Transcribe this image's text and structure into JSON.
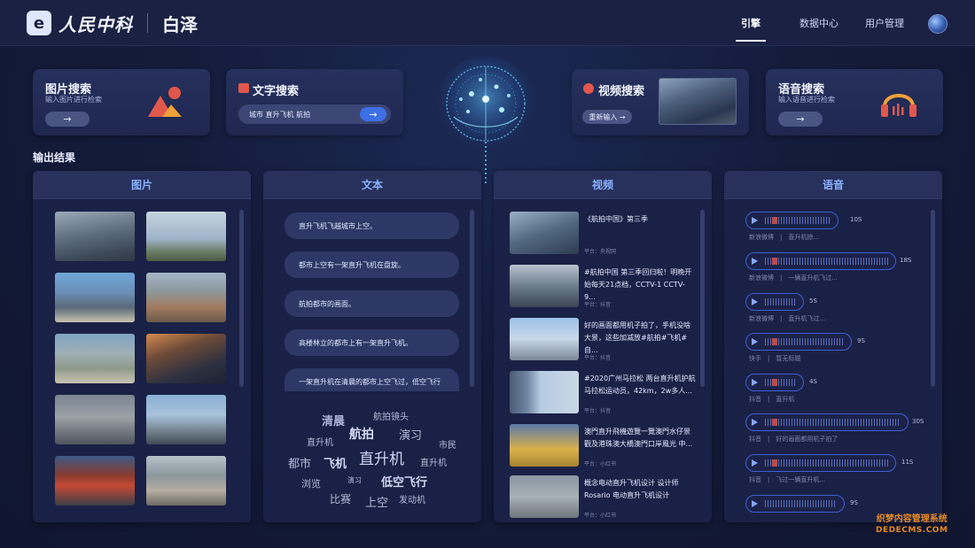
{
  "header": {
    "brand": "人民中科",
    "product": "白泽",
    "nav": [
      "引擎",
      "数据中心",
      "用户管理"
    ]
  },
  "search": {
    "image": {
      "title": "图片搜索",
      "subtitle": "输入图片进行检索",
      "button": "→"
    },
    "text": {
      "title": "文字搜索",
      "value": "城市 直升飞机 航拍",
      "button": "→"
    },
    "video": {
      "title": "视频搜索",
      "button": "重新输入 →"
    },
    "audio": {
      "title": "语音搜索",
      "subtitle": "输入语音进行检索",
      "button": "→"
    }
  },
  "output_label": "输出结果",
  "panels": {
    "image": {
      "title": "图片"
    },
    "text": {
      "title": "文本",
      "items": [
        "直升飞机飞越城市上空。",
        "都市上空有一架直升飞机在盘旋。",
        "航拍都市的画面。",
        "高楼林立的都市上有一架直升飞机。",
        "一架直升机在清晨的都市上空飞过，低空飞行"
      ],
      "word_cloud": [
        "清晨",
        "航拍镜头",
        "直升机",
        "航拍",
        "演习",
        "市民",
        "都市",
        "飞机",
        "直升机",
        "直升机",
        "浏览",
        "演习",
        "低空飞行",
        "比赛",
        "上空",
        "发动机"
      ]
    },
    "video": {
      "title": "视频",
      "items": [
        {
          "title": "《航拍中国》第三季",
          "meta": "平台：央视网"
        },
        {
          "title": "#航拍中国 第三季回归啦！明晚开始每天21点档，CCTV-1 CCTV-9...",
          "meta": "平台：抖音"
        },
        {
          "title": "好的画面都用机子拍了，手机没啥大景，这些加减放#航拍#飞机#自...",
          "meta": "平台：抖音"
        },
        {
          "title": "#2020广州马拉松 两台直升机护航马拉松运动员，42km，2w多人...",
          "meta": "平台：抖音"
        },
        {
          "title": "澳門直升飛機遊覽一覽澳門水仔景觀及港珠澳大橋澳門口岸風光 中...",
          "meta": "平台：小红书"
        },
        {
          "title": "概念电动直升飞机设计 设计师Rosario 电动直升飞机设计",
          "meta": "平台：小红书"
        }
      ]
    },
    "audio": {
      "title": "语音",
      "items": [
        {
          "duration": "10S",
          "source": "新浪微博",
          "text": "直升机掠..."
        },
        {
          "duration": "18S",
          "source": "新浪微博",
          "text": "一辆直升机飞过..."
        },
        {
          "duration": "5S",
          "source": "新浪微博",
          "text": "直升机飞过..."
        },
        {
          "duration": "9S",
          "source": "快手",
          "text": "暂无标题"
        },
        {
          "duration": "4S",
          "source": "抖音",
          "text": "直升机"
        },
        {
          "duration": "30S",
          "source": "抖音",
          "text": "好的画面都用机子拍了"
        },
        {
          "duration": "11S",
          "source": "抖音",
          "text": "飞过一辆直升机..."
        },
        {
          "duration": "9S",
          "source": "",
          "text": ""
        }
      ]
    }
  },
  "watermark": {
    "line1": "织梦内容管理系统",
    "line2": "DEDECMS.COM"
  },
  "colors": {
    "accent": "#3d6fe6",
    "panel_title": "#8ab0ff",
    "alert": "#e2574c"
  },
  "icons": [
    "arrow-right-icon",
    "image-icon",
    "text-icon",
    "video-icon",
    "headphones-icon",
    "play-icon",
    "brain-icon"
  ]
}
